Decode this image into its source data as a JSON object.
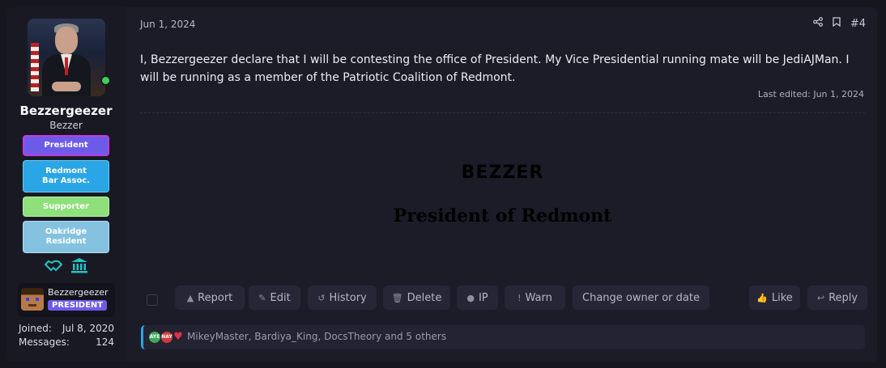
{
  "post": {
    "date": "Jun 1, 2024",
    "number": "#4",
    "body": "I, Bezzergeezer declare that I will be contesting the office of President. My Vice Presidential running mate will be JediAJMan. I will be running as a member of the Patriotic Coalition of Redmont.",
    "last_edited": "Last edited: Jun 1, 2024",
    "signature_line1": "BEZZER",
    "signature_line2": "President of Redmont"
  },
  "author": {
    "name": "Bezzergeezer",
    "title": "Bezzer",
    "badges": [
      "President",
      "Redmont Bar Assoc.",
      "Supporter",
      "Oakridge Resident"
    ],
    "mini_name": "Bezzergeezer",
    "mini_tag": "PRESIDENT",
    "joined_label": "Joined:",
    "joined_value": "Jul 8, 2020",
    "messages_label": "Messages:",
    "messages_value": "124",
    "icons": [
      "handshake-icon",
      "bank-icon"
    ]
  },
  "actions": {
    "report": "Report",
    "edit": "Edit",
    "history": "History",
    "delete": "Delete",
    "ip": "IP",
    "warn": "Warn",
    "change_owner": "Change owner or date",
    "like": "Like",
    "reply": "Reply"
  },
  "reactions": {
    "text": "MikeyMaster, Bardiya_King, DocsTheory and 5 others",
    "emoji_1": "AYE",
    "emoji_2": "NAY"
  },
  "colors": {
    "accent": "#6d5be8",
    "teal": "#23c4c2",
    "online": "#3ecf5b"
  }
}
